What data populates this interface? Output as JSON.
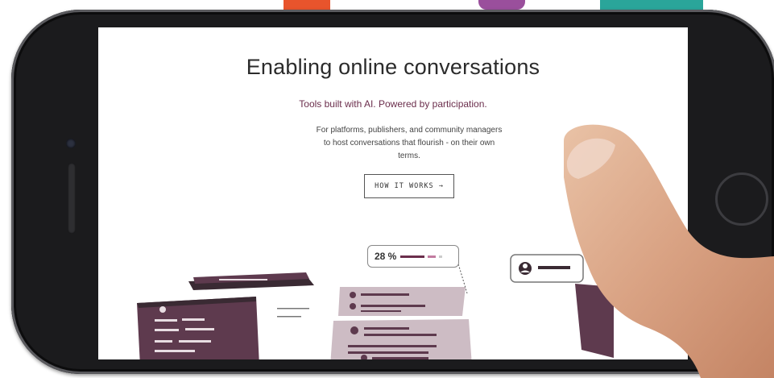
{
  "hero": {
    "title": "Enabling online conversations",
    "subtitle": "Tools built with AI. Powered by participation.",
    "description": "For platforms, publishers, and community managers to host conversations that flourish - on their own terms.",
    "cta_label": "HOW IT WORKS →"
  },
  "illustration": {
    "stat_value": "28 %"
  },
  "colors": {
    "brand": "#6b2e4c",
    "card_dark": "#5e3a4e",
    "card_light": "#cdbcc4"
  }
}
